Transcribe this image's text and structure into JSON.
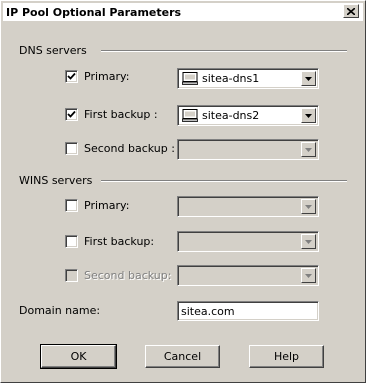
{
  "window": {
    "title": "IP Pool Optional Parameters"
  },
  "dns": {
    "group_label": "DNS servers",
    "primary": {
      "label": "Primary:",
      "checked": true,
      "value": "sitea-dns1"
    },
    "first_backup": {
      "label": "First backup :",
      "checked": true,
      "value": "sitea-dns2"
    },
    "second_backup": {
      "label": "Second backup :",
      "checked": false,
      "value": ""
    }
  },
  "wins": {
    "group_label": "WINS servers",
    "primary": {
      "label": "Primary:",
      "checked": false,
      "value": ""
    },
    "first_backup": {
      "label": "First backup:",
      "checked": false,
      "value": ""
    },
    "second_backup": {
      "label": "Second backup:",
      "checked": false,
      "value": "",
      "disabled": true
    }
  },
  "domain": {
    "label": "Domain name:",
    "value": "sitea.com"
  },
  "buttons": {
    "ok": "OK",
    "cancel": "Cancel",
    "help": "Help"
  }
}
